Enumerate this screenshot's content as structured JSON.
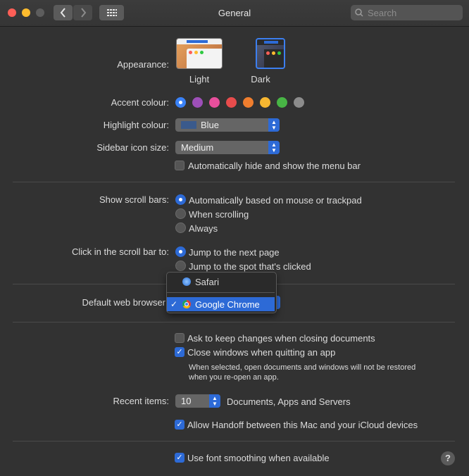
{
  "window": {
    "title": "General"
  },
  "search": {
    "placeholder": "Search"
  },
  "appearance": {
    "label": "Appearance:",
    "options": [
      {
        "name": "Light"
      },
      {
        "name": "Dark"
      }
    ],
    "selected": "Dark"
  },
  "accent": {
    "label": "Accent colour:",
    "colors": [
      "#3a82f7",
      "#9d4fb8",
      "#e84f9c",
      "#e84c4c",
      "#f07e2e",
      "#f7b731",
      "#48b545",
      "#8c8c8c"
    ],
    "selected_index": 0
  },
  "highlight": {
    "label": "Highlight colour:",
    "value": "Blue",
    "swatch": "#3a5a8c"
  },
  "sidebar_size": {
    "label": "Sidebar icon size:",
    "value": "Medium"
  },
  "menubar": {
    "label": "Automatically hide and show the menu bar",
    "checked": false
  },
  "scrollbars": {
    "label": "Show scroll bars:",
    "options": [
      "Automatically based on mouse or trackpad",
      "When scrolling",
      "Always"
    ],
    "selected_index": 0
  },
  "scroll_click": {
    "label": "Click in the scroll bar to:",
    "options": [
      "Jump to the next page",
      "Jump to the spot that's clicked"
    ],
    "selected_index": 0
  },
  "browser": {
    "label": "Default web browser",
    "menu": [
      "Safari",
      "Google Chrome"
    ],
    "selected": "Google Chrome"
  },
  "documents": {
    "ask_label": "Ask to keep changes when closing documents",
    "ask_checked": false,
    "close_label": "Close windows when quitting an app",
    "close_checked": true,
    "note_line1": "When selected, open documents and windows will not be restored",
    "note_line2": "when you re-open an app."
  },
  "recent": {
    "label": "Recent items:",
    "value": "10",
    "suffix": "Documents, Apps and Servers"
  },
  "handoff": {
    "label": "Allow Handoff between this Mac and your iCloud devices",
    "checked": true
  },
  "smoothing": {
    "label": "Use font smoothing when available",
    "checked": true
  },
  "help": {
    "symbol": "?"
  },
  "icons": {
    "back": "chevron-left-icon",
    "forward": "chevron-right-icon",
    "grid": "grid-icon",
    "search": "search-icon",
    "checkmark": "checkmark-icon"
  }
}
